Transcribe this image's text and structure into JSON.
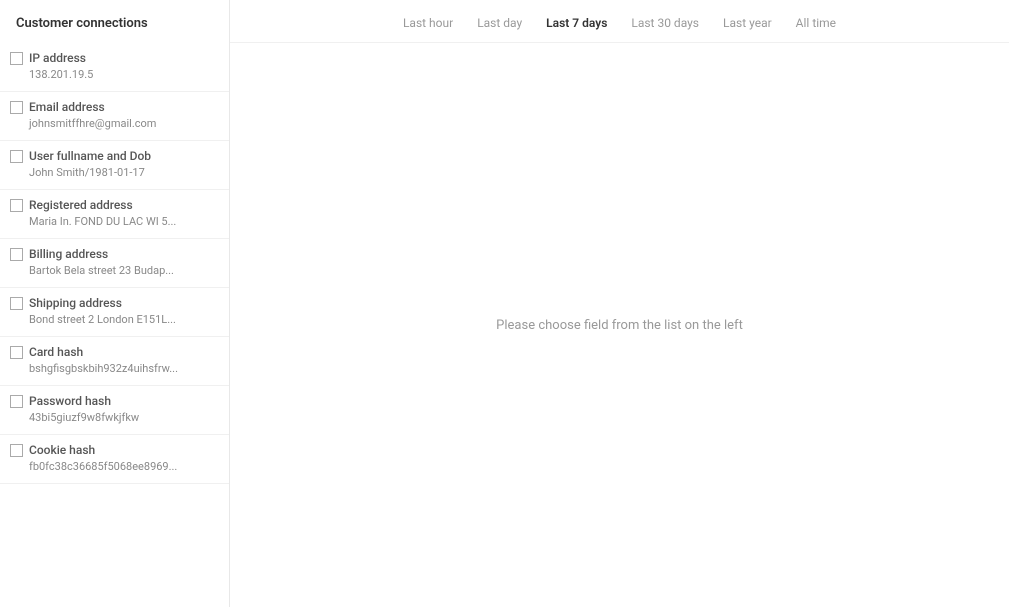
{
  "sidebar": {
    "title": "Customer connections",
    "items": [
      {
        "label": "IP address",
        "value": "138.201.19.5",
        "checked": false
      },
      {
        "label": "Email address",
        "value": "johnsmitffhre@gmail.com",
        "checked": false
      },
      {
        "label": "User fullname and Dob",
        "value": "John Smith/1981-01-17",
        "checked": false
      },
      {
        "label": "Registered address",
        "value": "Maria In. FOND DU LAC WI 5...",
        "checked": false
      },
      {
        "label": "Billing address",
        "value": "Bartok Bela street 23 Budap...",
        "checked": false
      },
      {
        "label": "Shipping address",
        "value": "Bond street 2 London E151L...",
        "checked": false
      },
      {
        "label": "Card hash",
        "value": "bshgfisgbskbih932z4uihsfrw...",
        "checked": false
      },
      {
        "label": "Password hash",
        "value": "43bi5giuzf9w8fwkjfkw",
        "checked": false
      },
      {
        "label": "Cookie hash",
        "value": "fb0fc38c36685f5068ee8969...",
        "checked": false
      }
    ]
  },
  "time_filters": {
    "options": [
      {
        "label": "Last hour",
        "active": false
      },
      {
        "label": "Last day",
        "active": false
      },
      {
        "label": "Last 7 days",
        "active": true
      },
      {
        "label": "Last 30 days",
        "active": false
      },
      {
        "label": "Last year",
        "active": false
      },
      {
        "label": "All time",
        "active": false
      }
    ]
  },
  "empty_state": {
    "message": "Please choose field from the list on the left"
  }
}
